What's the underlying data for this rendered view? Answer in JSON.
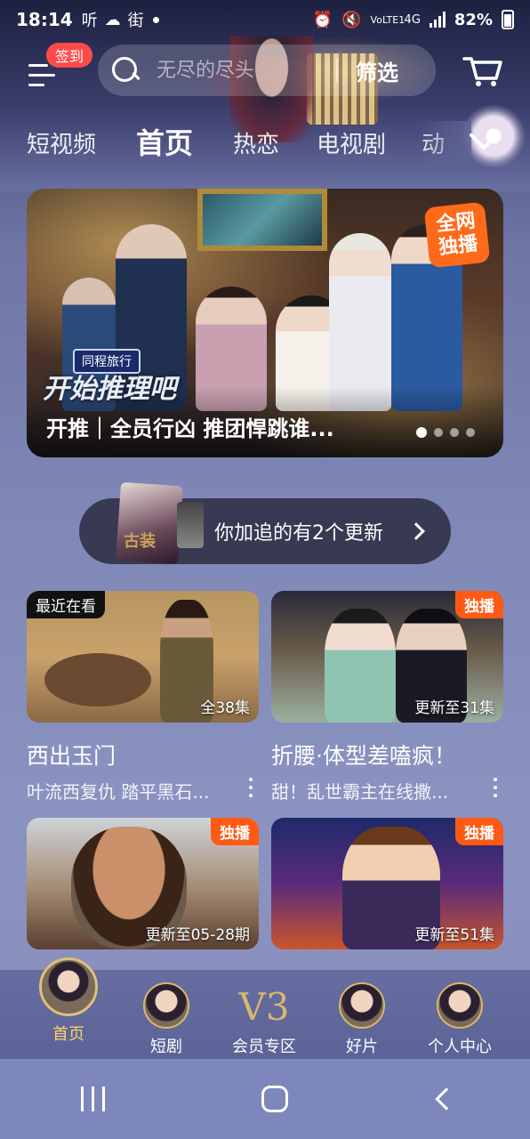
{
  "status_bar": {
    "time": "18:14",
    "left_icons": [
      "听",
      "街"
    ],
    "network": "4G",
    "volte": "VoLTE1",
    "battery": "82%"
  },
  "topbar": {
    "checkin_badge": "签到",
    "search_placeholder": "无尽的尽头",
    "filter_label": "筛选"
  },
  "tabs": [
    {
      "label": "短视频",
      "active": false
    },
    {
      "label": "首页",
      "active": true
    },
    {
      "label": "热恋",
      "active": false
    },
    {
      "label": "电视剧",
      "active": false
    },
    {
      "label": "动",
      "active": false
    }
  ],
  "banner": {
    "caption": "开推｜全员行凶 推团悍跳谁...",
    "big_title": "开始推理吧",
    "sponsor_chip": "同程旅行",
    "badge_line1": "全网",
    "badge_line2": "独播",
    "dot_count": 4,
    "active_dot": 1
  },
  "update_pill": {
    "text": "你加追的有2个更新",
    "poster_text": "古装"
  },
  "cards": [
    {
      "title": "西出玉门",
      "subtitle": "叶流西复仇 踏平黑石...",
      "tag": "最近在看",
      "tag_type": "recent",
      "episodes": "全38集"
    },
    {
      "title": "折腰·体型差嗑疯！",
      "subtitle": "甜！乱世霸主在线撒...",
      "tag": "独播",
      "tag_type": "exclusive",
      "episodes": "更新至31集"
    },
    {
      "title": "",
      "subtitle": "",
      "tag": "独播",
      "tag_type": "exclusive",
      "episodes": "更新至05-28期"
    },
    {
      "title": "",
      "subtitle": "",
      "tag": "独播",
      "tag_type": "exclusive",
      "episodes": "更新至51集"
    }
  ],
  "bottom_nav": [
    {
      "label": "首页",
      "active": true
    },
    {
      "label": "短剧",
      "active": false
    },
    {
      "label": "会员专区",
      "active": false,
      "logo": "V3"
    },
    {
      "label": "好片",
      "active": false
    },
    {
      "label": "个人中心",
      "active": false
    }
  ],
  "colors": {
    "accent_orange": "#ff5a14",
    "checkin_red": "#ff4a4a",
    "nav_active": "#ffd36a",
    "gold": "#d9b86a"
  },
  "icons": [
    "menu-icon",
    "search-icon",
    "cart-icon",
    "chevron-down-icon",
    "chevron-right-icon",
    "more-vertical-icon"
  ]
}
